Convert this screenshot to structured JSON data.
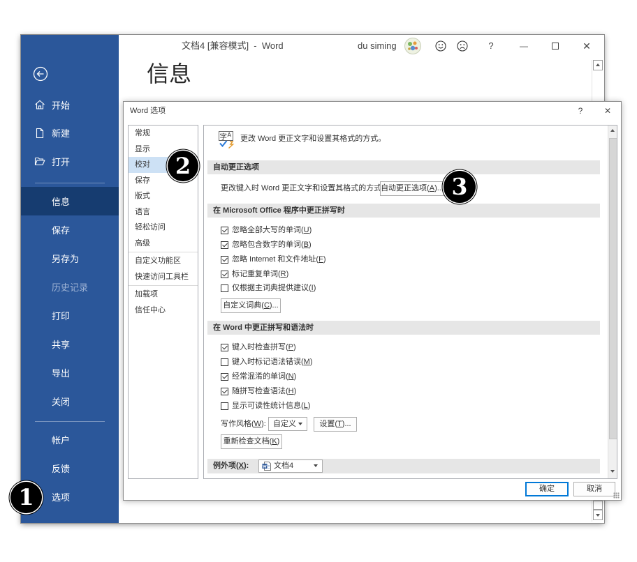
{
  "colors": {
    "accent": "#2b579a",
    "sidebar_selected": "#163c70",
    "ok_button_border": "#0078d7",
    "callout_fill": "#000000"
  },
  "word_window": {
    "title": "文档4 [兼容模式]  -  Word",
    "user_name": "du siming",
    "avatar_icon": "user-avatar",
    "feedback_icons": [
      "smile-icon",
      "frown-icon"
    ],
    "help": "?",
    "minimize": "—",
    "close": "✕"
  },
  "backstage": {
    "back_icon": "back-arrow-icon",
    "page_title": "信息",
    "nav_top": [
      {
        "label": "开始",
        "icon": "home-icon"
      },
      {
        "label": "新建",
        "icon": "new-document-icon"
      },
      {
        "label": "打开",
        "icon": "open-folder-icon"
      }
    ],
    "nav_main": [
      {
        "label": "信息",
        "selected": true
      },
      {
        "label": "保存"
      },
      {
        "label": "另存为"
      },
      {
        "label": "历史记录",
        "disabled": true
      },
      {
        "label": "打印"
      },
      {
        "label": "共享"
      },
      {
        "label": "导出"
      },
      {
        "label": "关闭"
      }
    ],
    "nav_bottom": [
      {
        "label": "帐户"
      },
      {
        "label": "反馈"
      },
      {
        "label": "选项"
      }
    ]
  },
  "options_dialog": {
    "title": "Word 选项",
    "help": "?",
    "close": "✕",
    "nav": [
      {
        "label": "常规"
      },
      {
        "label": "显示"
      },
      {
        "label": "校对",
        "selected": true
      },
      {
        "label": "保存"
      },
      {
        "label": "版式"
      },
      {
        "label": "语言"
      },
      {
        "label": "轻松访问"
      },
      {
        "label": "高级"
      },
      {
        "label": "自定义功能区"
      },
      {
        "label": "快速访问工具栏"
      },
      {
        "label": "加载项"
      },
      {
        "label": "信任中心"
      }
    ],
    "header": {
      "icon_glyph": "字",
      "icon_letter": "A",
      "text": "更改 Word 更正文字和设置其格式的方式。"
    },
    "autocorrect": {
      "heading": "自动更正选项",
      "description": "更改键入时 Word 更正文字和设置其格式的方式:",
      "button": "自动更正选项(A)..."
    },
    "office_spelling": {
      "heading": "在 Microsoft Office 程序中更正拼写时",
      "options": [
        {
          "label": "忽略全部大写的单词(U)",
          "checked": true
        },
        {
          "label": "忽略包含数字的单词(B)",
          "checked": true
        },
        {
          "label": "忽略 Internet 和文件地址(F)",
          "checked": true
        },
        {
          "label": "标记重复单词(R)",
          "checked": true
        },
        {
          "label": "仅根据主词典提供建议(I)",
          "checked": false
        }
      ],
      "dictionary_button": "自定义词典(C)..."
    },
    "word_spelling": {
      "heading": "在 Word 中更正拼写和语法时",
      "options": [
        {
          "label": "键入时检查拼写(P)",
          "checked": true
        },
        {
          "label": "键入时标记语法错误(M)",
          "checked": false
        },
        {
          "label": "经常混淆的单词(N)",
          "checked": true
        },
        {
          "label": "随拼写检查语法(H)",
          "checked": true
        },
        {
          "label": "显示可读性统计信息(L)",
          "checked": false
        }
      ],
      "writing_style_label": "写作风格(W):",
      "writing_style_value": "自定义",
      "settings_button": "设置(T)...",
      "recheck_button": "重新检查文档(K)"
    },
    "exceptions": {
      "label": "例外项(X):",
      "document": "文档4",
      "document_icon": "word-document-icon"
    },
    "ok_button": "确定",
    "cancel_button": "取消"
  },
  "callouts": [
    "1",
    "2",
    "3"
  ]
}
